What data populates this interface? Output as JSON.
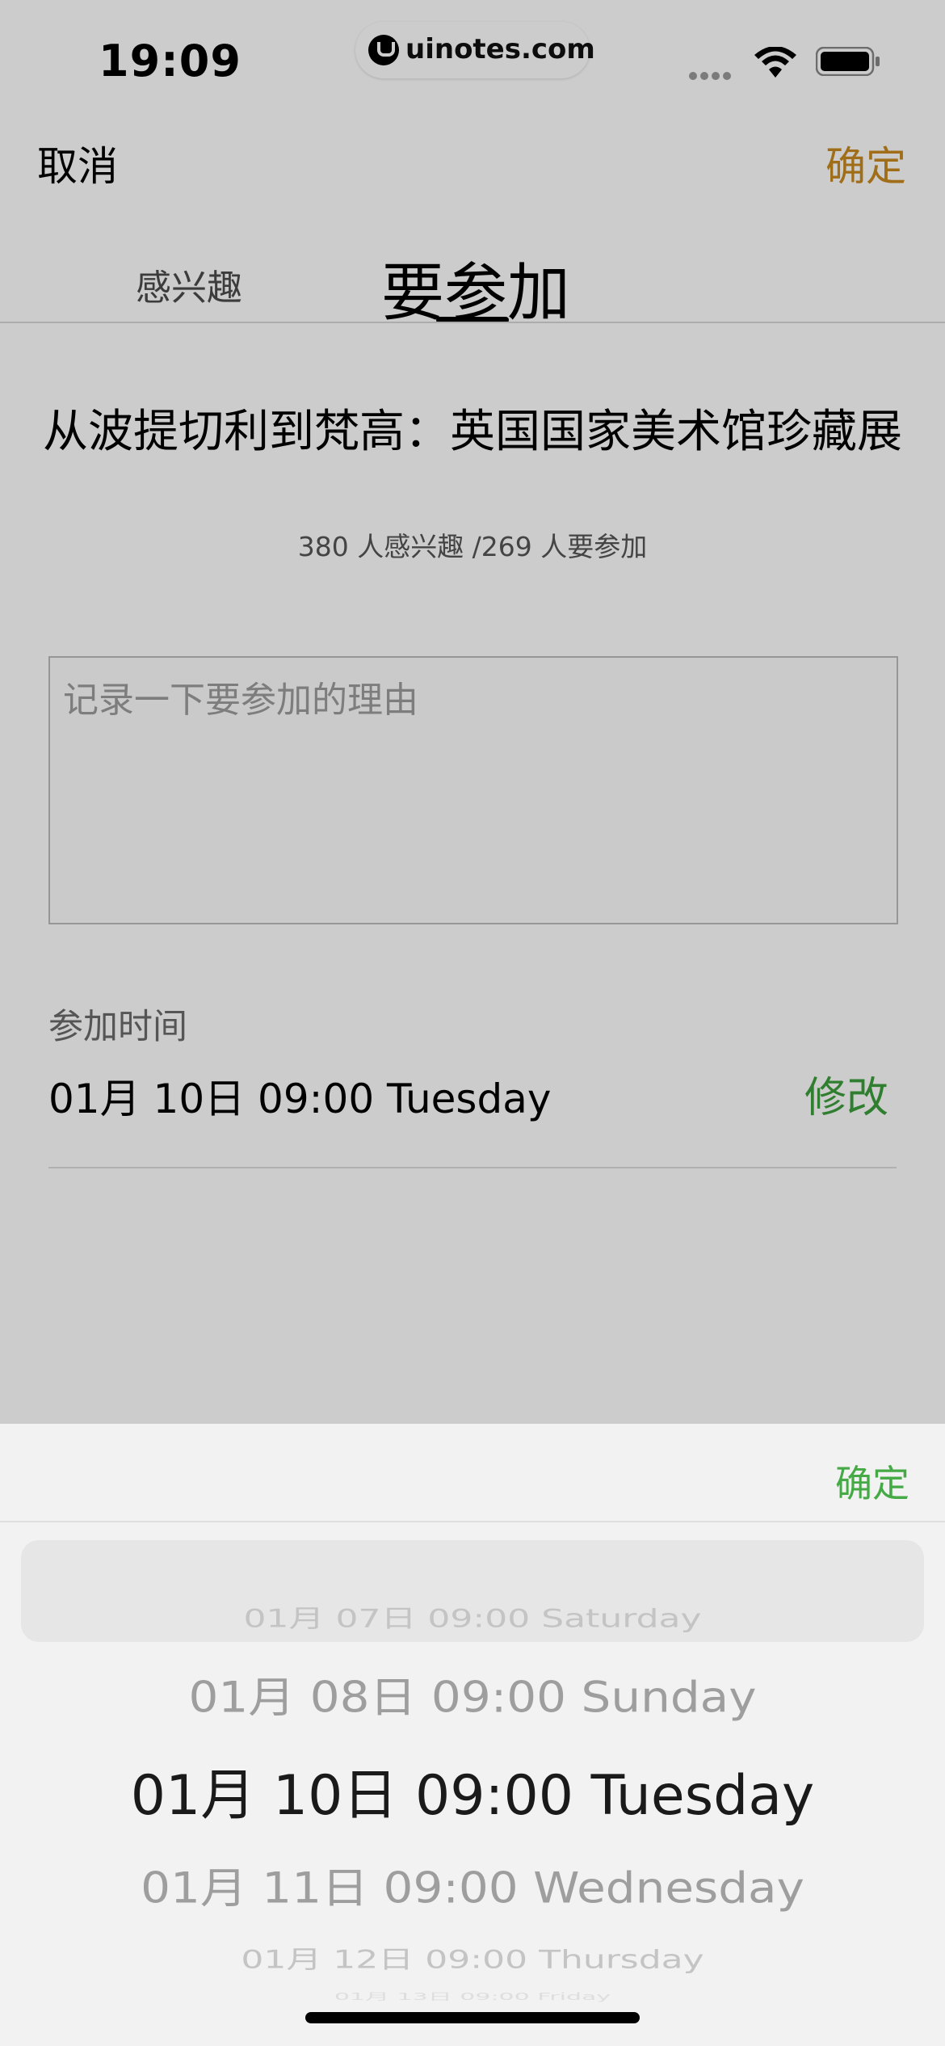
{
  "status_bar": {
    "time": "19:09",
    "url": "uinotes.com"
  },
  "nav": {
    "cancel": "取消",
    "confirm": "确定",
    "confirm_color": "#c98a1e"
  },
  "tabs": {
    "interest": "感兴趣",
    "attend": "要参加",
    "active": "attend"
  },
  "event": {
    "title": "从波提切利到梵高：英国国家美术馆珍藏展",
    "stats": "380 人感兴趣 /269 人要参加"
  },
  "reason": {
    "placeholder": "记录一下要参加的理由",
    "value": ""
  },
  "attend_time": {
    "label": "参加时间",
    "value": "01月 10日 09:00 Tuesday",
    "edit": "修改"
  },
  "picker": {
    "confirm": "确定",
    "accent_color": "#45aa45",
    "options": [
      "01月 07日 09:00 Saturday",
      "01月 08日 09:00 Sunday",
      "01月 10日 09:00 Tuesday",
      "01月 11日 09:00 Wednesday",
      "01月 12日 09:00 Thursday",
      "01月 13日 09:00 Friday"
    ],
    "selected": "01月 10日 09:00 Tuesday"
  }
}
